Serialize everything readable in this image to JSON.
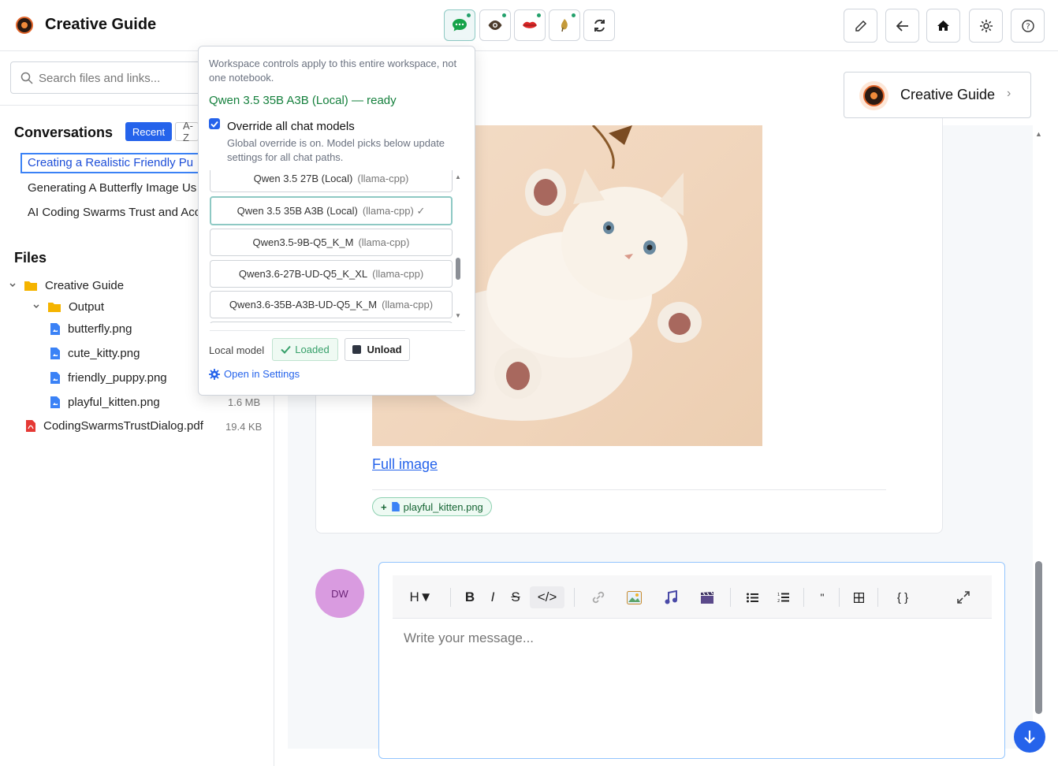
{
  "header": {
    "title": "Creative Guide",
    "mode_buttons": [
      "chat",
      "vision",
      "voice",
      "image-gen",
      "sync"
    ],
    "actions": [
      "edit",
      "back",
      "home",
      "settings",
      "help"
    ]
  },
  "sidebar": {
    "search_placeholder": "Search files and links...",
    "conversations_title": "Conversations",
    "sort_recent": "Recent",
    "sort_az": "A-Z",
    "conversations": [
      "Creating a Realistic Friendly Pu",
      "Generating A Butterfly Image Us",
      "AI Coding Swarms Trust and Acc"
    ],
    "files_title": "Files",
    "tree": {
      "root": "Creative Guide",
      "folder": "Output",
      "files": [
        "butterfly.png",
        "cute_kitty.png",
        "friendly_puppy.png",
        "playful_kitten.png"
      ],
      "last_file_size": "1.6 MB",
      "pdf": "CodingSwarmsTrustDialog.pdf",
      "pdf_size": "19.4 KB"
    }
  },
  "conversation_card": {
    "name": "Creative Guide"
  },
  "message": {
    "full_image_link": "Full image",
    "attachment": "playful_kitten.png"
  },
  "composer": {
    "avatar_initials": "DW",
    "placeholder": "Write your message...",
    "toolbar": {
      "heading": "H▼",
      "bold": "B",
      "italic": "I",
      "strike": "S",
      "code": "</>",
      "quote": "\"",
      "codeblock": "{ }"
    }
  },
  "popup": {
    "note": "Workspace controls apply to this entire workspace, not one notebook.",
    "status": "Qwen 3.5 35B A3B (Local) — ready",
    "override_label": "Override all chat models",
    "override_checked": true,
    "override_sub": "Global override is on. Model picks below update settings for all chat paths.",
    "models": [
      {
        "name": "Qwen 3.5 27B (Local)",
        "provider": "(llama-cpp)"
      },
      {
        "name": "Qwen 3.5 35B A3B (Local)",
        "provider": "(llama-cpp) ✓"
      },
      {
        "name": "Qwen3.5-9B-Q5_K_M",
        "provider": "(llama-cpp)"
      },
      {
        "name": "Qwen3.6-27B-UD-Q5_K_XL",
        "provider": "(llama-cpp)"
      },
      {
        "name": "Qwen3.6-35B-A3B-UD-Q5_K_M",
        "provider": "(llama-cpp)"
      }
    ],
    "local_model_label": "Local model",
    "loaded_label": "Loaded",
    "unload_label": "Unload",
    "settings_link": "Open in Settings"
  },
  "colors": {
    "accent": "#2563eb",
    "ready": "#15803d",
    "avatar": "#d99be0"
  }
}
